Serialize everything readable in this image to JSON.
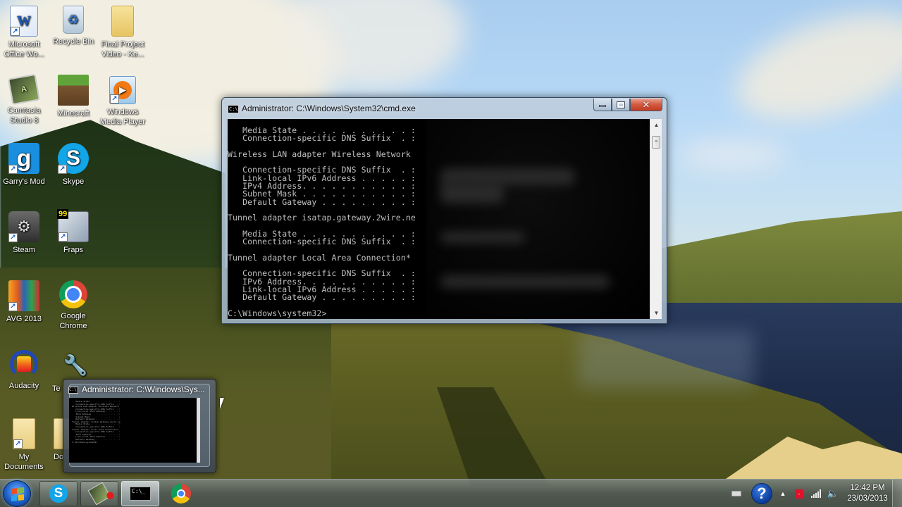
{
  "desktop": {
    "icons": [
      {
        "label": "Microsoft Office Wo...",
        "icon": "word-icon"
      },
      {
        "label": "Recycle Bin",
        "icon": "recycle-bin-icon"
      },
      {
        "label": "Final Project Video - Ke...",
        "icon": "folder-icon"
      },
      {
        "label": "Camtasia Studio 8",
        "icon": "camtasia-icon"
      },
      {
        "label": "Minecraft",
        "icon": "minecraft-icon"
      },
      {
        "label": "Windows Media Player",
        "icon": "media-player-icon"
      },
      {
        "label": "Garry's Mod",
        "icon": "garrys-mod-icon"
      },
      {
        "label": "Skype",
        "icon": "skype-icon"
      },
      {
        "label": "Steam",
        "icon": "steam-icon"
      },
      {
        "label": "Fraps",
        "icon": "fraps-icon"
      },
      {
        "label": "AVG 2013",
        "icon": "avg-icon"
      },
      {
        "label": "Google Chrome",
        "icon": "chrome-icon"
      },
      {
        "label": "Audacity",
        "icon": "audacity-icon"
      },
      {
        "label": "Te",
        "icon": "tools-icon"
      },
      {
        "label": "My Documents",
        "icon": "my-documents-icon"
      },
      {
        "label": "Do",
        "icon": "document-icon"
      }
    ],
    "fraps_counter": "99"
  },
  "cmd_window": {
    "title": "Administrator: C:\\Windows\\System32\\cmd.exe",
    "icon_text": "C:\\",
    "buttons": {
      "minimize": "minimize",
      "maximize": "maximize",
      "close": "✕"
    },
    "lines": [
      "   Media State . . . . . . . . . . . :",
      "   Connection-specific DNS Suffix  . :",
      "",
      "Wireless LAN adapter Wireless Network",
      "",
      "   Connection-specific DNS Suffix  . :",
      "   Link-local IPv6 Address . . . . . :",
      "   IPv4 Address. . . . . . . . . . . :",
      "   Subnet Mask . . . . . . . . . . . :",
      "   Default Gateway . . . . . . . . . :",
      "",
      "Tunnel adapter isatap.gateway.2wire.ne",
      "",
      "   Media State . . . . . . . . . . . :",
      "   Connection-specific DNS Suffix  . :",
      "",
      "Tunnel adapter Local Area Connection*",
      "",
      "   Connection-specific DNS Suffix  . :",
      "   IPv6 Address. . . . . . . . . . . :",
      "   Link-local IPv6 Address . . . . . :",
      "   Default Gateway . . . . . . . . . :",
      "",
      "C:\\Windows\\system32>"
    ],
    "scrollbar": {
      "up": "▲",
      "down": "▼",
      "thumb": "≡"
    }
  },
  "thumbnail_preview": {
    "title": "Administrator: C:\\Windows\\Sys...",
    "icon_text": "C:\\"
  },
  "taskbar": {
    "start_label": "Start",
    "buttons": [
      {
        "name": "skype",
        "label": "S"
      },
      {
        "name": "camtasia-recorder",
        "label": ""
      },
      {
        "name": "command-prompt",
        "label": "C:\\_"
      },
      {
        "name": "google-chrome",
        "label": ""
      }
    ],
    "tray": {
      "help_label": "?",
      "show_hidden_label": "▲",
      "notification_badge": "-",
      "speaker_label": "🔈",
      "time": "12:42 PM",
      "date": "23/03/2013"
    }
  }
}
